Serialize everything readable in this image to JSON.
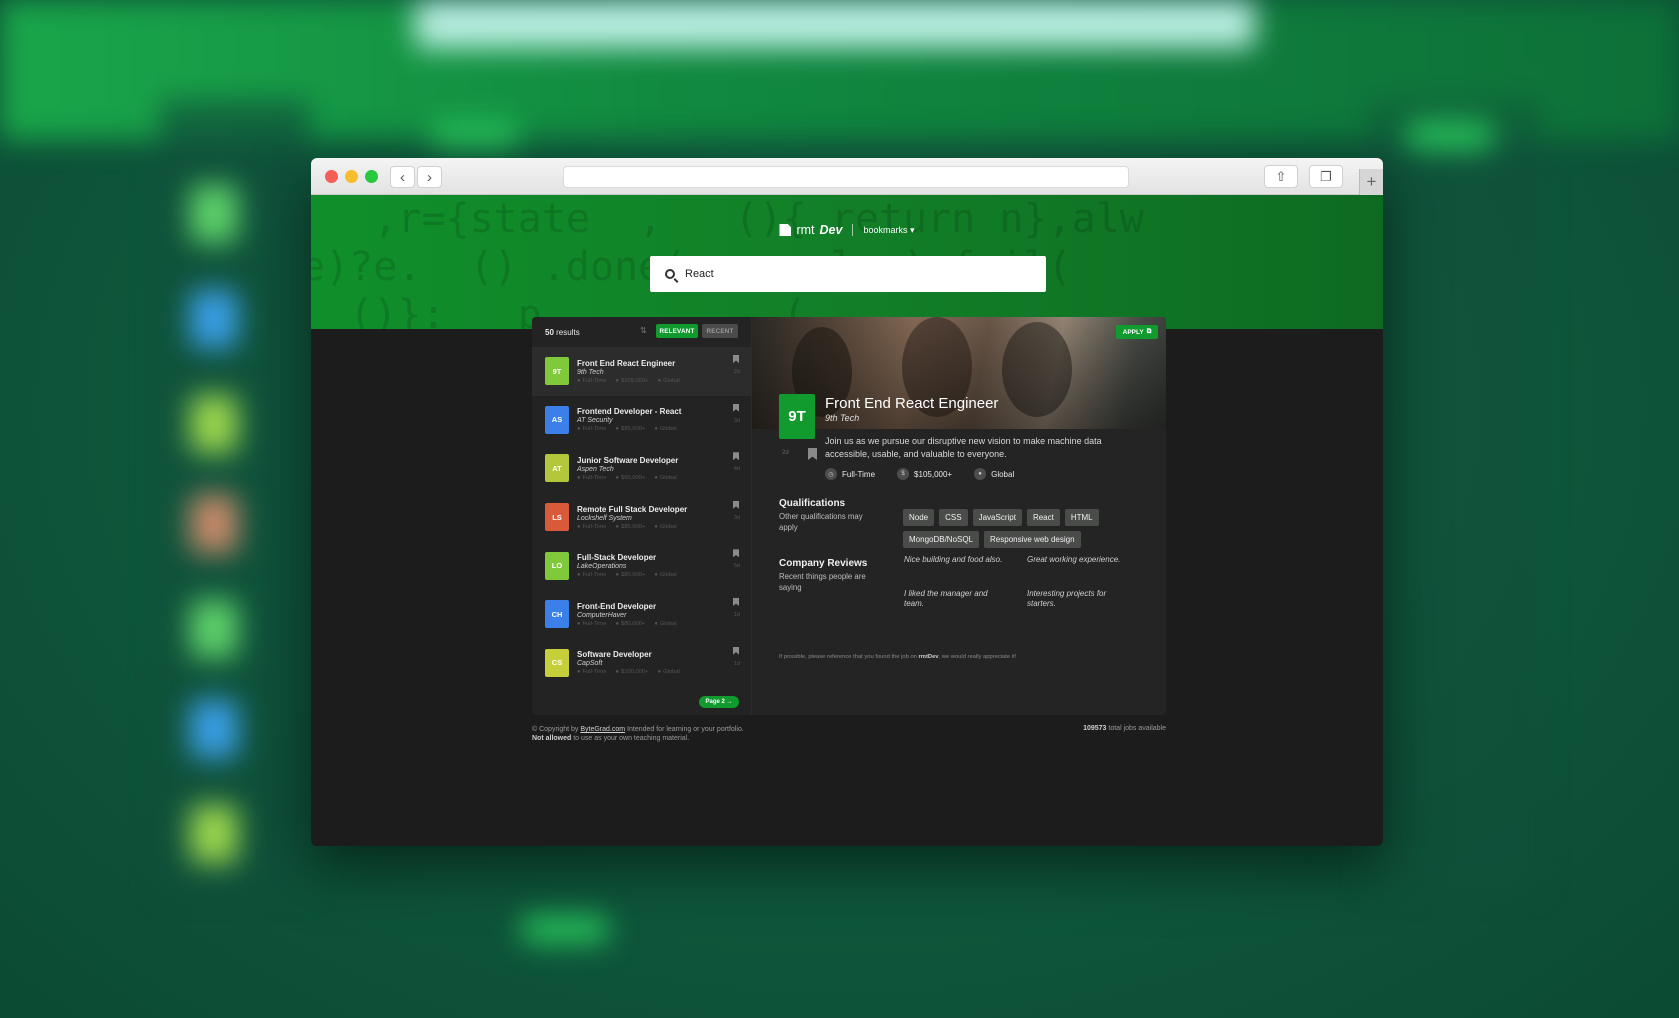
{
  "app": {
    "logo_text": "rmt",
    "logo_bold": "Dev",
    "bookmarks_label": "bookmarks ▾"
  },
  "search": {
    "value": "React"
  },
  "list": {
    "results_count": "50",
    "results_label": "results",
    "sort_relevant": "RELEVANT",
    "sort_recent": "RECENT",
    "page_button": "Page 2 →",
    "items": [
      {
        "badge": "9T",
        "badge_color": "#7fc93b",
        "title": "Front End React Engineer",
        "company": "9th Tech",
        "type": "Full-Time",
        "salary": "$105,000+",
        "location": "Global",
        "age": "2d"
      },
      {
        "badge": "AS",
        "badge_color": "#3a80e8",
        "title": "Frontend Developer - React",
        "company": "AT Security",
        "type": "Full-Time",
        "salary": "$85,000+",
        "location": "Global",
        "age": "3d"
      },
      {
        "badge": "AT",
        "badge_color": "#b4c63a",
        "title": "Junior Software Developer",
        "company": "Aspen Tech",
        "type": "Full-Time",
        "salary": "$60,000+",
        "location": "Global",
        "age": "4d"
      },
      {
        "badge": "LS",
        "badge_color": "#d85a3a",
        "title": "Remote Full Stack Developer",
        "company": "Lockshelf System",
        "type": "Full-Time",
        "salary": "$85,000+",
        "location": "Global",
        "age": "3d"
      },
      {
        "badge": "LO",
        "badge_color": "#7fc93b",
        "title": "Full-Stack Developer",
        "company": "LakeOperations",
        "type": "Full-Time",
        "salary": "$80,000+",
        "location": "Global",
        "age": "5d"
      },
      {
        "badge": "CH",
        "badge_color": "#3a80e8",
        "title": "Front-End Developer",
        "company": "ComputerHaver",
        "type": "Full-Time",
        "salary": "$80,000+",
        "location": "Global",
        "age": "1d"
      },
      {
        "badge": "CS",
        "badge_color": "#c6cf3a",
        "title": "Software Developer",
        "company": "CapSoft",
        "type": "Full-Time",
        "salary": "$100,000+",
        "location": "Global",
        "age": "1d"
      }
    ]
  },
  "detail": {
    "apply_label": "APPLY",
    "badge": "9T",
    "age": "2d",
    "title": "Front End React Engineer",
    "company": "9th Tech",
    "description": "Join us as we pursue our disruptive new vision to make machine data accessible, usable, and valuable to everyone.",
    "type": "Full-Time",
    "salary": "$105,000+",
    "location": "Global",
    "qualifications_title": "Qualifications",
    "qualifications_sub": "Other qualifications may apply",
    "tags": [
      "Node",
      "CSS",
      "JavaScript",
      "React",
      "HTML",
      "MongoDB/NoSQL",
      "Responsive web design"
    ],
    "reviews_title": "Company Reviews",
    "reviews_sub": "Recent things people are saying",
    "reviews": [
      "Nice building and food also.",
      "Great working experience.",
      "I liked the manager and team.",
      "Interesting projects for starters."
    ],
    "footnote_pre": "If possible, please reference that you found the job on ",
    "footnote_brand": "rmtDev",
    "footnote_post": ", we would really appreciate it!"
  },
  "footer": {
    "copyright_pre": "© Copyright by ",
    "copyright_link": "ByteGrad.com",
    "copyright_post": " Intended for learning or your portfolio.",
    "not_allowed": "Not allowed",
    "not_allowed_post": " to use as your own teaching material.",
    "total_jobs": "109573",
    "total_jobs_label": " total jobs available"
  }
}
